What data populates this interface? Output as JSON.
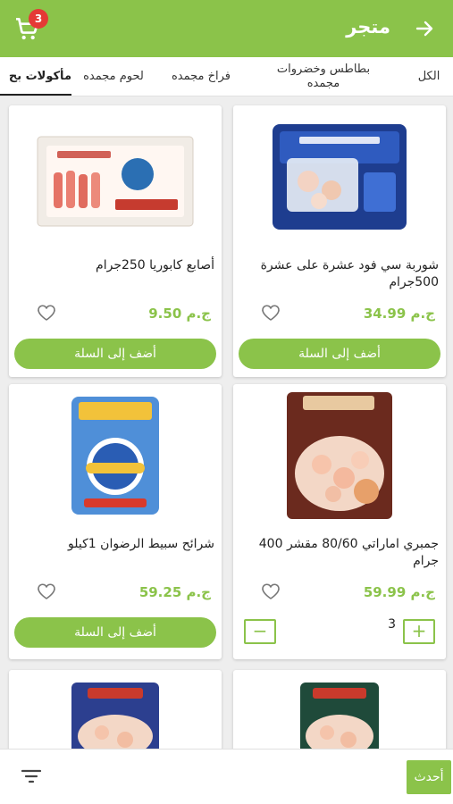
{
  "header": {
    "title": "متجر",
    "cart_count": "3"
  },
  "tabs": [
    {
      "label": "الكل"
    },
    {
      "label_line1": "بطاطس وخضروات",
      "label_line2": "مجمده"
    },
    {
      "label": "فراخ مجمده"
    },
    {
      "label": "لحوم مجمده"
    },
    {
      "label": "مأكولات بح"
    }
  ],
  "products": [
    {
      "name": "شوربة سي فود عشرة على عشرة 500جرام",
      "price": "ج.م 34.99",
      "action": "أضف إلى السلة"
    },
    {
      "name": "أصابع كابوريا 250جرام",
      "price": "ج.م 9.50",
      "action": "أضف إلى السلة"
    },
    {
      "name": "جمبري اماراتي 80/60 مقشر 400 جرام",
      "price": "ج.م 59.99",
      "quantity": "3",
      "minus": "−",
      "plus": "+"
    },
    {
      "name": "شرائح سبيط الرضوان 1كيلو",
      "price": "ج.م 59.25",
      "action": "أضف إلى السلة"
    }
  ],
  "bottom": {
    "update_label": "أحدث"
  },
  "colors": {
    "brand": "#8bc34a",
    "badge": "#e53935"
  }
}
